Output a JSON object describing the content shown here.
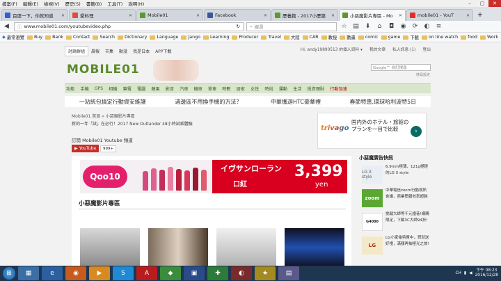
{
  "menubar": [
    "檔案(F)",
    "編輯(E)",
    "檢視(V)",
    "歷史(S)",
    "書籤(B)",
    "工具(T)",
    "說明(H)"
  ],
  "window_controls": [
    "–",
    "▢",
    "✕"
  ],
  "tabs": [
    {
      "label": "百度一下，你就知道",
      "icon_color": "#2f61d5",
      "active": false
    },
    {
      "label": "愛料理",
      "icon_color": "#e14b3b",
      "active": false
    },
    {
      "label": "Mobile01",
      "icon_color": "#5a9a2a",
      "active": false
    },
    {
      "label": "Facebook",
      "icon_color": "#3b5998",
      "active": false
    },
    {
      "label": "歷養篇 - 2017小歷篇",
      "icon_color": "#5a9a2a",
      "active": false
    },
    {
      "label": "小惡魔影片專區 - Mo",
      "icon_color": "#5a9a2a",
      "active": true
    },
    {
      "label": "mobile01 - YouT",
      "icon_color": "#e52d27",
      "active": false
    }
  ],
  "navbar": {
    "url": "www.mobile01.com/youtubevideo.php",
    "search_placeholder": "搜尋"
  },
  "bookmarks": [
    "最常瀏覽",
    "Buy",
    "Bank",
    "Contact",
    "Search",
    "Dictionary",
    "Language",
    "Jango",
    "Learning",
    "Producer",
    "Travel",
    "大陸",
    "CAR",
    "教授",
    "動畫",
    "comic",
    "game",
    "下載",
    "on line watch",
    "food",
    "Work"
  ],
  "site": {
    "top_tabs": [
      "討論群組",
      "晨報",
      "市集",
      "動漫",
      "我是日本",
      "APP下載"
    ],
    "user_links": [
      "Hi, andy19890513 的個人資料 ▾",
      "我的文章",
      "私人訊息 (1)",
      "登出"
    ],
    "logo": "MOBILE01",
    "google_placeholder": "Google™ 自訂搜尋",
    "advanced_search": "搜尋設定",
    "categories": [
      "功能",
      "手機",
      "GPS",
      "相機",
      "筆電",
      "電腦",
      "蘋果",
      "影音",
      "汽車",
      "機車",
      "單車",
      "時數",
      "居家",
      "女性",
      "時尚",
      "運動",
      "生活",
      "投資理財",
      "行動加速"
    ],
    "promos": [
      "一站統包搞定行動資安維護",
      "週邊區不用換手機的方法？",
      "中華攜迦HTC豪華禮",
      "春節特惠,環球哈利波特5日"
    ],
    "breadcrumb": "Mobile01 首頁 » 小惡魔影片專區",
    "news": "新的一年「試」在必行！2017 New Outlander 48小時試乘體驗",
    "ad": {
      "brand": "trivago",
      "text": "国内外のホテル・旅館のプランを一目で比較",
      "arrow": "›"
    },
    "subscribe_label": "訂閱 Mobile01 Youtube 頻道",
    "youtube_button": "YouTube",
    "youtube_count": "999+",
    "banner": {
      "brand": "Qoo10",
      "headline": "イヴサンローラン",
      "product": "口紅",
      "price": "3,399",
      "unit": "yen"
    },
    "section_title": "小惡魔影片專區",
    "sidebar_title": "小惡魔廣告快訊",
    "sidebar_items": [
      {
        "text": "6.9mm極薄、121g極輕的LG X style",
        "brand": "LG X style"
      },
      {
        "text": "中華電信zoom行動視訊會議，商業簡報效率超越",
        "brand": "zoom"
      },
      {
        "text": "挑戰大師等千元撞巷!網購限定，下載3C大師94折!",
        "brand": "G4000"
      },
      {
        "text": "LG小家電特賣中，買就送好禮，滿額再抽極光之旅!",
        "brand": "LG"
      }
    ]
  },
  "taskbar": {
    "tray_lang": "CH",
    "time": "下午 08:23",
    "date": "2016/12/28"
  }
}
